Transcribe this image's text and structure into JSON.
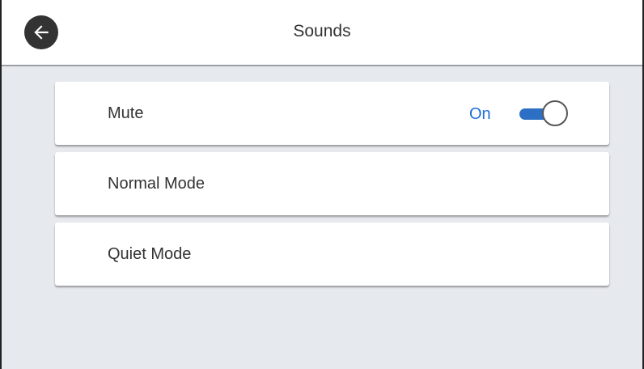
{
  "header": {
    "title": "Sounds",
    "back_icon": "arrow-left-icon"
  },
  "items": [
    {
      "label": "Mute",
      "toggle_state": "On",
      "toggle_on": true
    },
    {
      "label": "Normal Mode"
    },
    {
      "label": "Quiet Mode"
    }
  ],
  "colors": {
    "accent": "#2d6fc4",
    "toggle_text": "#1d6fd6",
    "background": "#e6e9ed"
  }
}
